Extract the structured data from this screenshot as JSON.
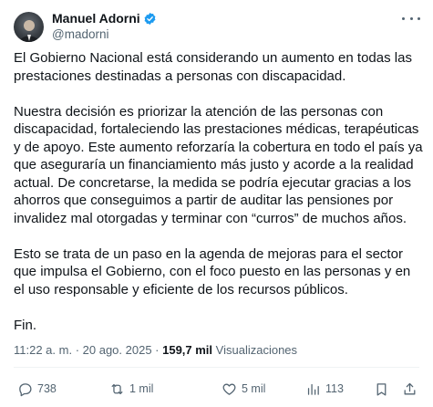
{
  "author": {
    "display_name": "Manuel Adorni",
    "handle": "@madorni",
    "verified": true,
    "verified_color": "#1d9bf0"
  },
  "tweet": {
    "paragraphs": [
      "El Gobierno Nacional está considerando un aumento en todas las prestaciones destinadas a personas con discapacidad.",
      "Nuestra decisión es priorizar la atención de las personas con discapacidad, fortaleciendo las prestaciones médicas, terapéuticas y de apoyo. Este aumento reforzaría la cobertura en todo el país ya que aseguraría un financiamiento más justo y acorde a la realidad actual. De concretarse, la medida se podría ejecutar gracias a los ahorros que conseguimos a partir de auditar las pensiones por invalidez mal otorgadas y terminar con “curros” de muchos años.",
      "Esto se trata de un paso en la agenda de mejoras para el sector que impulsa el Gobierno, con el foco puesto en las personas y en el uso responsable y eficiente de los recursos públicos.",
      "Fin."
    ]
  },
  "meta": {
    "time": "11:22 a. m.",
    "separator": " · ",
    "date": "20 ago. 2025",
    "views_count": "159,7 mil",
    "views_label": "Visualizaciones"
  },
  "actions": {
    "replies": "738",
    "reposts": "1 mil",
    "likes": "5 mil",
    "views": "113"
  },
  "icons": {
    "reply": "reply-icon",
    "repost": "repost-icon",
    "like": "heart-icon",
    "views": "views-icon",
    "bookmark": "bookmark-icon",
    "share": "share-icon",
    "more": "more-icon"
  },
  "colors": {
    "text": "#0f1419",
    "secondary": "#536471",
    "divider": "#eff3f4"
  }
}
